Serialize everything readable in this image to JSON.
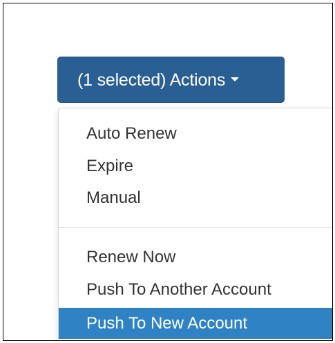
{
  "actions": {
    "button_label": "(1 selected) Actions"
  },
  "menu": {
    "group_one": [
      {
        "label": "Auto Renew"
      },
      {
        "label": "Expire"
      },
      {
        "label": "Manual"
      }
    ],
    "group_two": [
      {
        "label": "Renew Now"
      },
      {
        "label": "Push To Another Account"
      },
      {
        "label": "Push To New Account",
        "active": true
      }
    ]
  },
  "colors": {
    "button_background": "#2a5f93",
    "highlight_background": "#2f83c4",
    "text": "#333333"
  },
  "icons": {
    "caret": "caret-down-icon"
  }
}
